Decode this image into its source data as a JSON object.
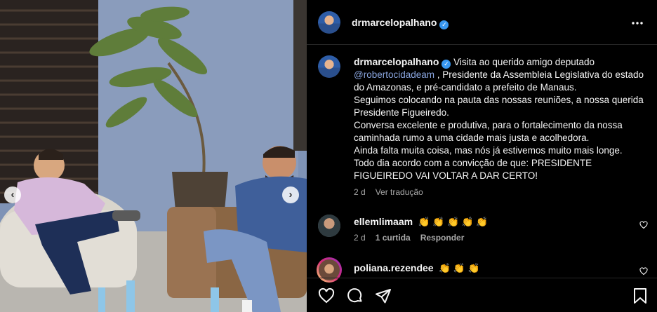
{
  "post": {
    "username": "drmarcelopalhano",
    "verified_mark": "✓",
    "more_icon": "more-horizontal-icon"
  },
  "caption": {
    "username": "drmarcelopalhano",
    "intro": "Visita ao querido amigo deputado",
    "mention": "@robertocidadeam",
    "rest": ", Presidente da Assembleia Legislativa do estado do Amazonas, e pré-candidato a prefeito de Manaus.",
    "lines": [
      "Seguimos colocando na pauta das nossas reuniões, a nossa querida Presidente Figueiredo.",
      "Conversa excelente e produtiva, para o fortalecimento da nossa caminhada rumo a uma cidade mais justa e acolhedora.",
      "Ainda falta muita coisa, mas nós já estivemos muito mais longe.",
      "Todo dia acordo com a convicção de que: PRESIDENTE FIGUEIREDO VAI VOLTAR A DAR CERTO!"
    ],
    "time": "2 d",
    "translate": "Ver tradução"
  },
  "comments": [
    {
      "username": "ellemlimaam",
      "text": "👏 👏 👏 👏 👏",
      "time": "2 d",
      "likes": "1 curtida",
      "reply": "Responder"
    },
    {
      "username": "poliana.rezendee",
      "text": "👏 👏 👏"
    }
  ],
  "actions": {
    "icons": [
      "heart-icon",
      "comment-icon",
      "share-icon",
      "bookmark-icon"
    ]
  },
  "photo": {
    "prev": "‹",
    "next": "›"
  },
  "colors": {
    "accent": "#3897f0",
    "mention": "#8aa6e0",
    "muted": "#a8a8a8"
  }
}
